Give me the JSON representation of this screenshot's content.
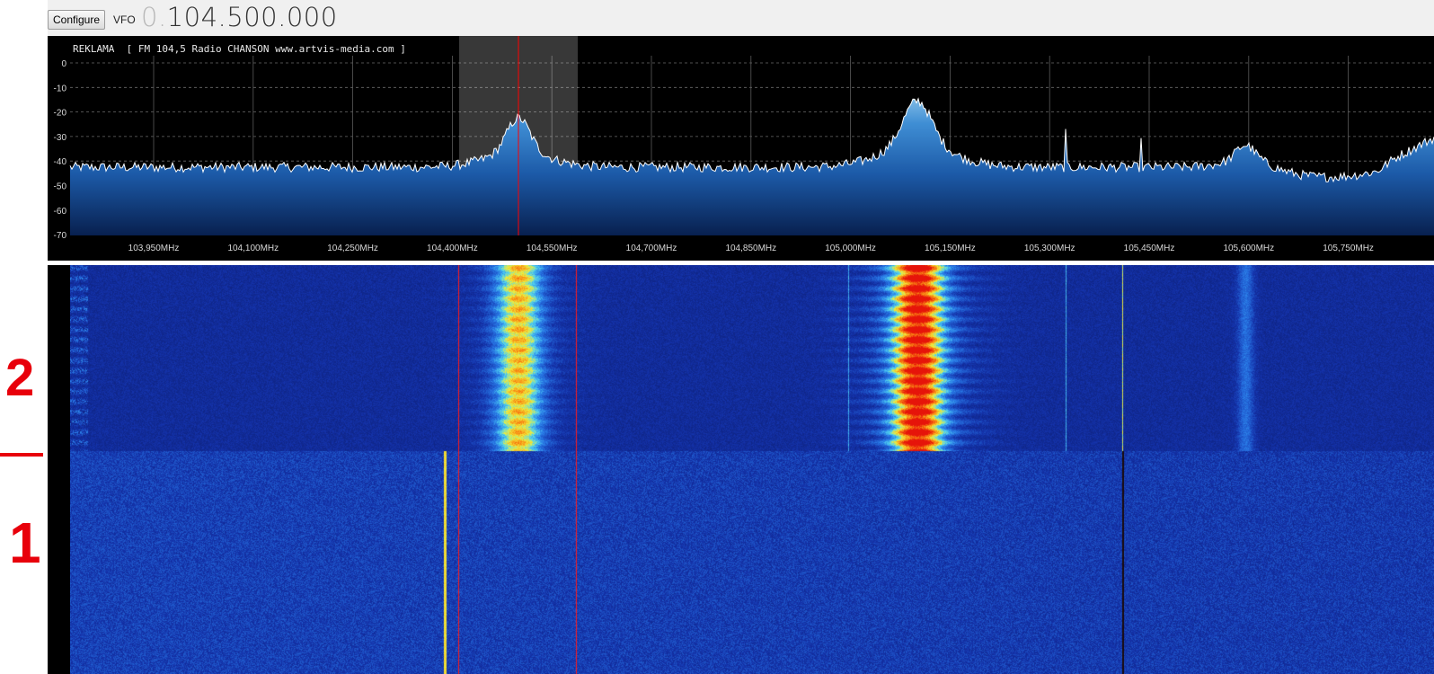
{
  "toolbar": {
    "configure_label": "Configure",
    "vfo_label": "VFO",
    "vfo_prefix": "0.",
    "vfo_value": "104.500.000"
  },
  "spectrum": {
    "rds_text": "REKLAMA  [ FM 104,5 Radio CHANSON www.artvis-media.com ]",
    "db_ticks": [
      "0",
      "-10",
      "-20",
      "-30",
      "-40",
      "-50",
      "-60",
      "-70"
    ],
    "freq_ticks": [
      "103,950MHz",
      "104,100MHz",
      "104,250MHz",
      "104,400MHz",
      "104,550MHz",
      "104,700MHz",
      "104,850MHz",
      "105,000MHz",
      "105,150MHz",
      "105,300MHz",
      "105,450MHz",
      "105,600MHz",
      "105,750MHz"
    ]
  },
  "annotations": {
    "label_2": "2",
    "label_1": "1"
  },
  "colors": {
    "trace": "#ffffff",
    "fill_top": "#5fa8e0",
    "fill_bottom": "#0b2a6a",
    "marker": "#ff0000",
    "annotation": "#e8000b"
  }
}
